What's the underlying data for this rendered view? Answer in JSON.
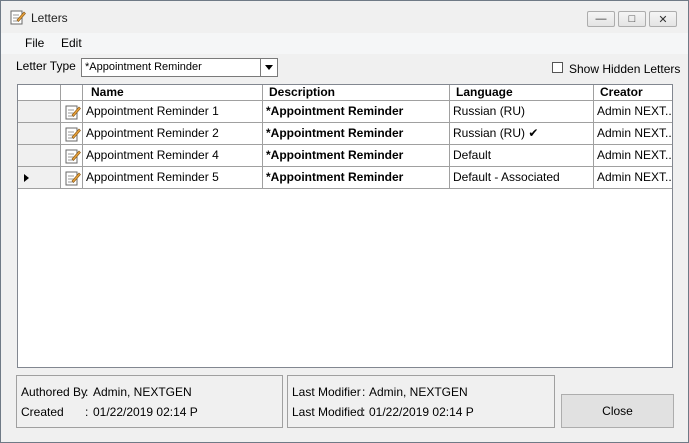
{
  "window": {
    "title": "Letters"
  },
  "menu": {
    "file": "File",
    "edit": "Edit"
  },
  "filter": {
    "letter_type_label": "Letter Type",
    "letter_type_value": "*Appointment Reminder",
    "show_hidden_label": "Show Hidden Letters",
    "show_hidden_checked": false
  },
  "grid": {
    "columns": [
      "Name",
      "Description",
      "Language",
      "Creator"
    ],
    "rows": [
      {
        "name": "Appointment Reminder 1",
        "description": "*Appointment Reminder",
        "language": "Russian (RU)",
        "creator": "Admin NEXT..."
      },
      {
        "name": "Appointment Reminder 2",
        "description": "*Appointment Reminder",
        "language": "Russian (RU) ✔",
        "creator": "Admin NEXT..."
      },
      {
        "name": "Appointment Reminder 4",
        "description": "*Appointment Reminder",
        "language": "Default",
        "creator": "Admin NEXT..."
      },
      {
        "name": "Appointment Reminder 5",
        "description": "*Appointment Reminder",
        "language": "Default - Associated",
        "creator": "Admin NEXT..."
      }
    ],
    "current_row_index": 3
  },
  "details": {
    "authored_by_label": "Authored By",
    "authored_by_value": "Admin, NEXTGEN",
    "created_label": "Created",
    "created_value": "01/22/2019 02:14 P",
    "last_modifier_label": "Last Modifier",
    "last_modifier_value": "Admin, NEXTGEN",
    "last_modified_label": "Last Modified",
    "last_modified_value": "01/22/2019 02:14 P",
    "separator": ":"
  },
  "buttons": {
    "close": "Close"
  },
  "icons": {
    "title": "edit-document-icon",
    "row": "edit-document-icon",
    "current_row": "row-pointer-icon"
  }
}
